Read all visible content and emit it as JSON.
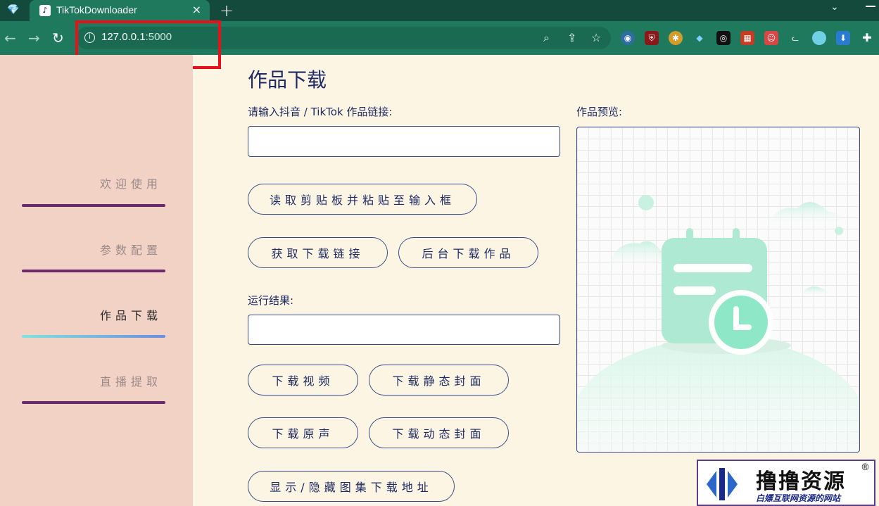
{
  "browser": {
    "tab_title": "TikTokDownloader",
    "tab_favicon": "tiktok-icon",
    "tab_close": "×",
    "new_tab": "+",
    "url_host": "127.0.0.1",
    "url_port": ":5000",
    "highlight_color": "#e8101a",
    "extensions": [
      "earth-icon",
      "ublock-icon",
      "puzzle-globe-icon",
      "gem-icon",
      "glasses-icon",
      "grid-icon",
      "santa-icon",
      "cat-icon",
      "circle-icon",
      "download-icon",
      "puzzle-icon"
    ]
  },
  "sidebar": {
    "items": [
      {
        "label": "欢迎使用",
        "active": false
      },
      {
        "label": "参数配置",
        "active": false
      },
      {
        "label": "作品下载",
        "active": true
      },
      {
        "label": "直播提取",
        "active": false
      }
    ]
  },
  "main": {
    "title": "作品下载",
    "link_label": "请输入抖音 / TikTok 作品链接:",
    "link_value": "",
    "paste_button": "读取剪贴板并粘贴至输入框",
    "get_link_button": "获取下载链接",
    "bg_download_button": "后台下载作品",
    "result_label": "运行结果:",
    "result_value": "",
    "download_video_button": "下载视频",
    "download_static_cover_button": "下载静态封面",
    "download_audio_button": "下载原声",
    "download_dynamic_cover_button": "下载动态封面",
    "toggle_gallery_button": "显示/隐藏图集下载地址",
    "preview_label": "作品预览:"
  },
  "watermark": {
    "title": "撸撸资源",
    "reg": "®",
    "subtitle": "白嫖互联网资源的网站"
  },
  "colors": {
    "sidebar_bg": "#f2d2c4",
    "page_bg": "#fdf5e4",
    "text_navy": "#1d2a64",
    "nav_bar": "#6b2a6b",
    "illustration": "#8ee8c8"
  }
}
